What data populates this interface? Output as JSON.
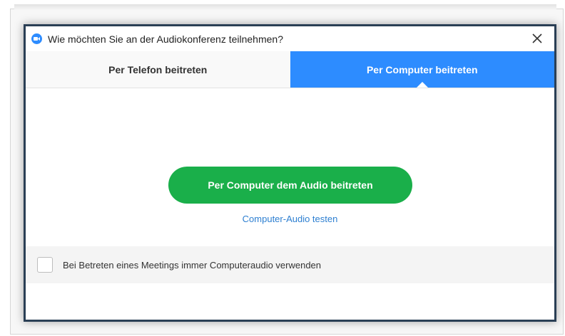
{
  "dialog": {
    "title": "Wie möchten Sie an der Audiokonferenz teilnehmen?",
    "close_symbol": "✕",
    "app_icon": "zoom-camera-icon"
  },
  "tabs": [
    {
      "label": "Per Telefon beitreten",
      "selected": false
    },
    {
      "label": "Per Computer beitreten",
      "selected": true
    }
  ],
  "main": {
    "join_button_label": "Per Computer dem Audio beitreten",
    "test_link_label": "Computer-Audio testen"
  },
  "footer": {
    "checkbox_label": "Bei Betreten eines Meetings immer Computeraudio verwenden",
    "checked": false
  },
  "colors": {
    "accent_blue": "#2d8cff",
    "join_green": "#1aaf4a",
    "link_blue": "#2d7fd1"
  }
}
